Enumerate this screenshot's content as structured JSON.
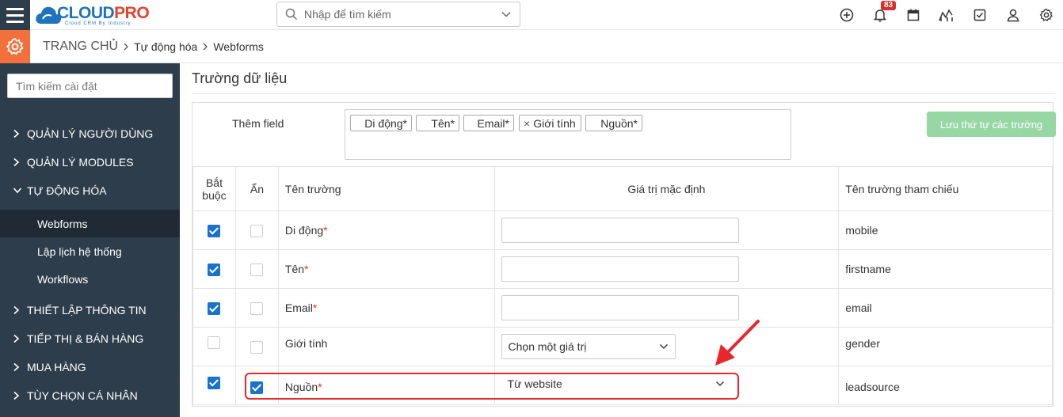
{
  "brand": {
    "logo_main": "CLOUD",
    "logo_accent": "PRO",
    "logo_tagline": "Cloud CRM By Industry"
  },
  "search": {
    "placeholder": "Nhập để tìm kiếm"
  },
  "notifications": {
    "count": "83"
  },
  "breadcrumb": {
    "home": "TRANG CHỦ",
    "level1": "Tự động hóa",
    "level2": "Webforms"
  },
  "sidebar": {
    "search_placeholder": "Tìm kiếm cài đặt",
    "items": [
      {
        "label": "QUẢN LÝ NGƯỜI DÙNG",
        "expanded": false
      },
      {
        "label": "QUẢN LÝ MODULES",
        "expanded": false
      },
      {
        "label": "TỰ ĐỘNG HÓA",
        "expanded": true
      },
      {
        "label": "THIẾT LẬP THÔNG TIN",
        "expanded": false
      },
      {
        "label": "TIẾP THỊ & BÁN HÀNG",
        "expanded": false
      },
      {
        "label": "MUA HÀNG",
        "expanded": false
      },
      {
        "label": "TÙY CHỌN CÁ NHÂN",
        "expanded": false
      }
    ],
    "subitems": [
      {
        "label": "Webforms",
        "active": true
      },
      {
        "label": "Lập lịch hệ thống",
        "active": false
      },
      {
        "label": "Workflows",
        "active": false
      }
    ]
  },
  "main": {
    "section_title": "Trường dữ liệu",
    "add_field_label": "Thêm field",
    "tags": [
      "Di động*",
      "Tên*",
      "Email*",
      "Giới tính",
      "Nguồn*"
    ],
    "tag_remove_symbol": "×",
    "save_order_label": "Lưu thứ tự các trường",
    "table": {
      "headers": {
        "required": "Bắt buộc",
        "hidden": "Ẩn",
        "name": "Tên trường",
        "default": "Giá trị mặc định",
        "ref": "Tên trường tham chiếu"
      },
      "rows": [
        {
          "name": "Di động",
          "star": "*",
          "required": true,
          "hidden": false,
          "default_type": "text",
          "default_value": "",
          "ref": "mobile"
        },
        {
          "name": "Tên",
          "star": "*",
          "required": true,
          "hidden": false,
          "default_type": "text",
          "default_value": "",
          "ref": "firstname"
        },
        {
          "name": "Email",
          "star": "*",
          "required": true,
          "hidden": false,
          "default_type": "text",
          "default_value": "",
          "ref": "email"
        },
        {
          "name": "Giới tính",
          "star": "",
          "required": false,
          "hidden": false,
          "default_type": "select",
          "default_value": "Chọn một giá trị",
          "ref": "gender"
        },
        {
          "name": "Nguồn",
          "star": "*",
          "required": true,
          "hidden": true,
          "default_type": "select",
          "default_value": "Từ website",
          "ref": "leadsource"
        }
      ]
    }
  },
  "colors": {
    "sidebar_bg": "#2e3d4c",
    "accent_orange": "#f36f3b",
    "checkbox_blue": "#1a73c9",
    "annotation_red": "#e8262c",
    "save_button_green": "#96d7a4"
  }
}
